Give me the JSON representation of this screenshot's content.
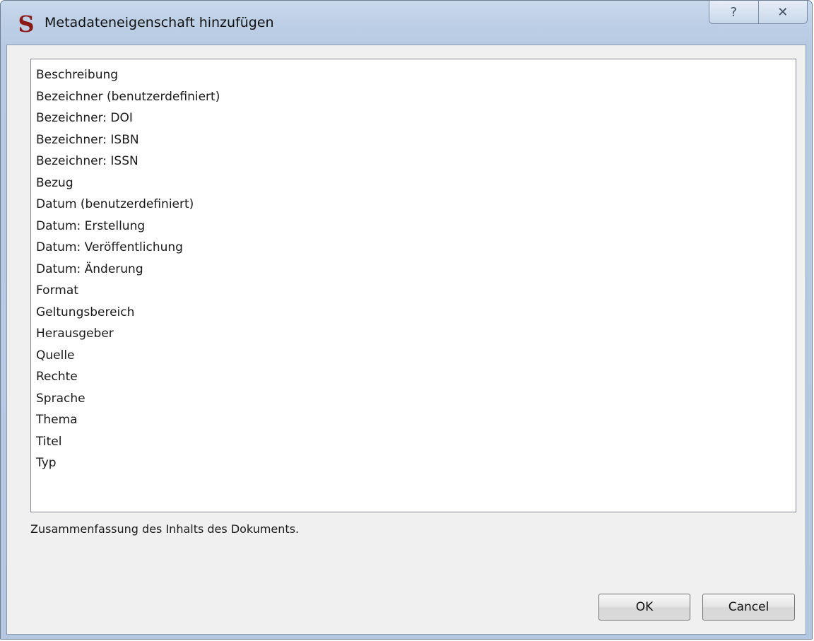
{
  "window": {
    "title": "Metadateneigenschaft hinzufügen",
    "app_icon_glyph": "S",
    "help_glyph": "?",
    "close_glyph": "✕"
  },
  "list": {
    "items": [
      "Beschreibung",
      "Bezeichner (benutzerdefiniert)",
      "Bezeichner: DOI",
      "Bezeichner: ISBN",
      "Bezeichner: ISSN",
      "Bezug",
      "Datum (benutzerdefiniert)",
      "Datum: Erstellung",
      "Datum: Veröffentlichung",
      "Datum: Änderung",
      "Format",
      "Geltungsbereich",
      "Herausgeber",
      "Quelle",
      "Rechte",
      "Sprache",
      "Thema",
      "Titel",
      "Typ"
    ]
  },
  "description": "Zusammenfassung des Inhalts des Dokuments.",
  "buttons": {
    "ok": "OK",
    "cancel": "Cancel"
  }
}
